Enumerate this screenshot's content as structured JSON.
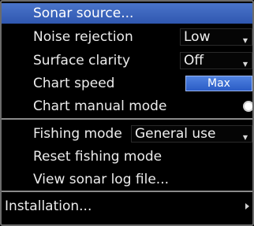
{
  "menu": {
    "items": [
      {
        "label": "Sonar source..."
      },
      {
        "label": "Noise rejection",
        "value": "Low"
      },
      {
        "label": "Surface clarity",
        "value": "Off"
      },
      {
        "label": "Chart speed",
        "button": "Max"
      },
      {
        "label": "Chart manual mode"
      },
      {
        "label": "Fishing mode",
        "value": "General use"
      },
      {
        "label": "Reset fishing mode"
      },
      {
        "label": "View sonar log file..."
      },
      {
        "label": "Installation..."
      }
    ]
  },
  "colors": {
    "selection": "#3a64bd",
    "background": "#000000",
    "text": "#ececec",
    "divider": "#8a8a8a",
    "button": "#2f62cc"
  }
}
